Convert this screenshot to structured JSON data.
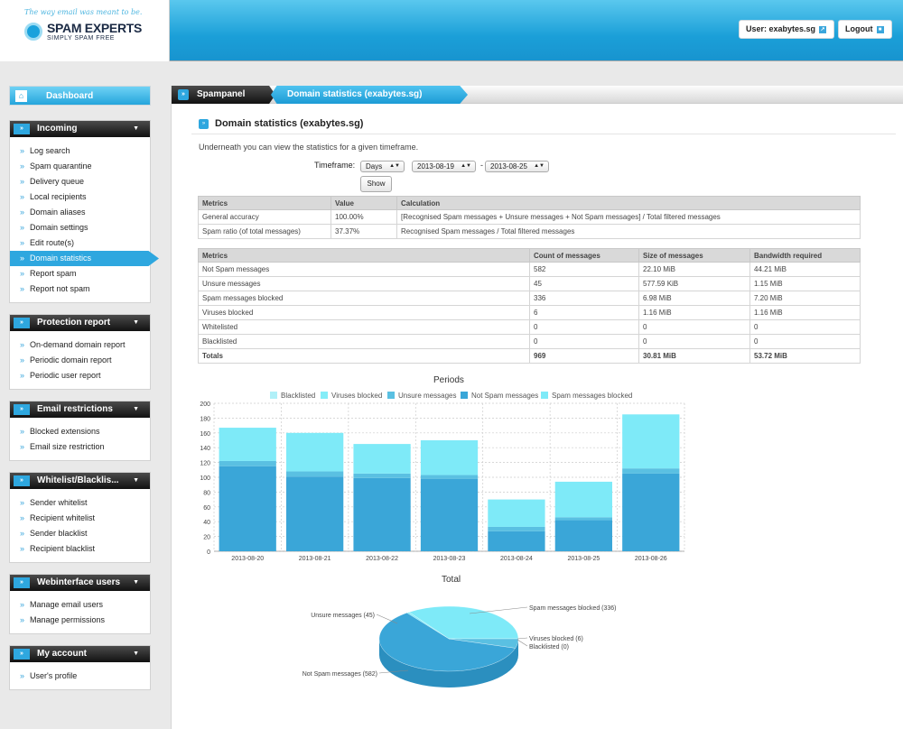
{
  "header": {
    "tagline": "The way email was meant to be.",
    "logo_main": "SPAM EXPERTS",
    "logo_sub": "SIMPLY SPAM FREE",
    "user_label": "User: exabytes.sg",
    "logout_label": "Logout"
  },
  "sidebar": {
    "dashboard": "Dashboard",
    "sections": [
      {
        "title": "Incoming",
        "items": [
          "Log search",
          "Spam quarantine",
          "Delivery queue",
          "Local recipients",
          "Domain aliases",
          "Domain settings",
          "Edit route(s)",
          "Domain statistics",
          "Report spam",
          "Report not spam"
        ]
      },
      {
        "title": "Protection report",
        "items": [
          "On-demand domain report",
          "Periodic domain report",
          "Periodic user report"
        ]
      },
      {
        "title": "Email restrictions",
        "items": [
          "Blocked extensions",
          "Email size restriction"
        ]
      },
      {
        "title": "Whitelist/Blacklis...",
        "items": [
          "Sender whitelist",
          "Recipient whitelist",
          "Sender blacklist",
          "Recipient blacklist"
        ]
      },
      {
        "title": "Webinterface users",
        "items": [
          "Manage email users",
          "Manage permissions"
        ]
      },
      {
        "title": "My account",
        "items": [
          "User's profile"
        ]
      }
    ]
  },
  "breadcrumb": {
    "root": "Spampanel",
    "current": "Domain statistics (exabytes.sg)"
  },
  "page": {
    "title": "Domain statistics (exabytes.sg)",
    "intro": "Underneath you can view the statistics for a given timeframe.",
    "timeframe_label": "Timeframe:",
    "period": "Days",
    "from": "2013-08-19",
    "to": "2013-08-25",
    "dash": "-",
    "show_label": "Show"
  },
  "metrics_table": {
    "headers": [
      "Metrics",
      "Value",
      "Calculation"
    ],
    "rows": [
      [
        "General accuracy",
        "100.00%",
        "[Recognised Spam messages + Unsure messages + Not Spam messages] / Total filtered messages"
      ],
      [
        "Spam ratio (of total messages)",
        "37.37%",
        "Recognised Spam messages / Total filtered messages"
      ]
    ]
  },
  "counts_table": {
    "headers": [
      "Metrics",
      "Count of messages",
      "Size of messages",
      "Bandwidth required"
    ],
    "rows": [
      [
        "Not Spam messages",
        "582",
        "22.10 MiB",
        "44.21 MiB"
      ],
      [
        "Unsure messages",
        "45",
        "577.59 KiB",
        "1.15 MiB"
      ],
      [
        "Spam messages blocked",
        "336",
        "6.98 MiB",
        "7.20 MiB"
      ],
      [
        "Viruses blocked",
        "6",
        "1.16 MiB",
        "1.16 MiB"
      ],
      [
        "Whitelisted",
        "0",
        "0",
        "0"
      ],
      [
        "Blacklisted",
        "0",
        "0",
        "0"
      ],
      [
        "Totals",
        "969",
        "30.81 MiB",
        "53.72 MiB"
      ]
    ]
  },
  "colors": {
    "blacklisted": "#b0f0f8",
    "viruses": "#84edf8",
    "unsure": "#5ac0e2",
    "notspam": "#3aa6d8",
    "spam": "#7eeaf8"
  },
  "chart_data": [
    {
      "type": "bar",
      "title": "Periods",
      "stacked": true,
      "categories": [
        "2013-08-20",
        "2013-08-21",
        "2013-08-22",
        "2013-08-23",
        "2013-08-24",
        "2013-08-25",
        "2013-08-26"
      ],
      "series": [
        {
          "name": "Blacklisted",
          "values": [
            0,
            0,
            0,
            0,
            0,
            0,
            0
          ]
        },
        {
          "name": "Viruses blocked",
          "values": [
            0,
            0,
            0,
            0,
            0,
            0,
            0
          ]
        },
        {
          "name": "Unsure messages",
          "values": [
            7,
            7,
            6,
            5,
            6,
            4,
            7
          ]
        },
        {
          "name": "Not Spam messages",
          "values": [
            115,
            101,
            99,
            98,
            27,
            42,
            105
          ]
        },
        {
          "name": "Spam messages blocked",
          "values": [
            45,
            52,
            40,
            47,
            37,
            48,
            73
          ]
        }
      ],
      "yticks": [
        "0",
        "20",
        "40",
        "60",
        "80",
        "100",
        "120",
        "140",
        "160",
        "180",
        "200"
      ],
      "ylim": [
        0,
        200
      ],
      "grid": true,
      "legend": "top"
    },
    {
      "type": "pie",
      "title": "Total",
      "labels": [
        "Spam messages blocked (336)",
        "Viruses blocked (6)",
        "Blacklisted (0)",
        "Not Spam messages (582)",
        "Unsure messages (45)"
      ],
      "values": [
        336,
        6,
        0,
        582,
        45
      ]
    }
  ]
}
